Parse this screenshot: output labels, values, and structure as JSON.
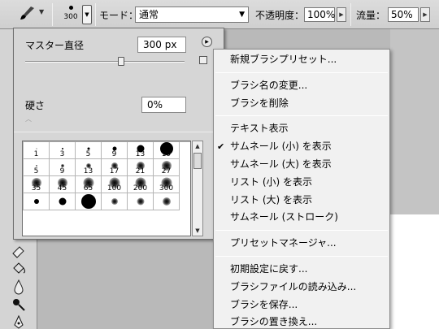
{
  "options_bar": {
    "brush_size": "300",
    "mode_label": "モード：",
    "mode_value": "通常",
    "opacity_label": "不透明度：",
    "opacity_value": "100%",
    "flow_label": "流量：",
    "flow_value": "50%"
  },
  "brush_panel": {
    "master_diameter_label": "マスター直径",
    "master_diameter_value": "300 px",
    "master_diameter_fraction": 0.6,
    "hardness_label": "硬さ",
    "hardness_value": "0%",
    "brushes": [
      {
        "label": "1",
        "style": "hard"
      },
      {
        "label": "3",
        "style": "hard"
      },
      {
        "label": "5",
        "style": "hard"
      },
      {
        "label": "9",
        "style": "hard"
      },
      {
        "label": "13",
        "style": "hard"
      },
      {
        "label": "19",
        "style": "hard"
      },
      {
        "label": "5",
        "style": "soft"
      },
      {
        "label": "9",
        "style": "soft"
      },
      {
        "label": "13",
        "style": "soft"
      },
      {
        "label": "17",
        "style": "soft"
      },
      {
        "label": "21",
        "style": "soft"
      },
      {
        "label": "27",
        "style": "soft"
      },
      {
        "label": "35",
        "style": "soft"
      },
      {
        "label": "45",
        "style": "soft"
      },
      {
        "label": "65",
        "style": "soft"
      },
      {
        "label": "100",
        "style": "soft"
      },
      {
        "label": "200",
        "style": "soft"
      },
      {
        "label": "300",
        "style": "soft"
      },
      {
        "label": "",
        "style": "hard"
      },
      {
        "label": "",
        "style": "hard"
      },
      {
        "label": "",
        "style": "hard"
      },
      {
        "label": "",
        "style": "soft"
      },
      {
        "label": "",
        "style": "soft"
      },
      {
        "label": "",
        "style": "soft"
      }
    ]
  },
  "context_menu": {
    "items": [
      {
        "label": "新規ブラシプリセット...",
        "checked": false
      },
      {
        "sep": true
      },
      {
        "label": "ブラシ名の変更...",
        "checked": false
      },
      {
        "label": "ブラシを削除",
        "checked": false
      },
      {
        "sep": true
      },
      {
        "label": "テキスト表示",
        "checked": false
      },
      {
        "label": "サムネール (小) を表示",
        "checked": true
      },
      {
        "label": "サムネール (大) を表示",
        "checked": false
      },
      {
        "label": "リスト (小) を表示",
        "checked": false
      },
      {
        "label": "リスト (大) を表示",
        "checked": false
      },
      {
        "label": "サムネール (ストローク)",
        "checked": false
      },
      {
        "sep": true
      },
      {
        "label": "プリセットマネージャ...",
        "checked": false
      },
      {
        "sep": true
      },
      {
        "label": "初期設定に戻す...",
        "checked": false
      },
      {
        "label": "ブラシファイルの読み込み...",
        "checked": false
      },
      {
        "label": "ブラシを保存...",
        "checked": false
      },
      {
        "label": "ブラシの置き換え...",
        "checked": false
      }
    ],
    "check_glyph": "✔"
  },
  "icons": {
    "brush_tool": "brush-tool-icon",
    "menu_arrow": "circle-arrow-icon",
    "tools": [
      "eraser-icon",
      "paint-bucket-icon",
      "blur-icon",
      "dodge-icon",
      "pen-icon"
    ]
  },
  "colors": {
    "menu_bg": "#f1f1f1",
    "panel_bg": "#d6d6d6",
    "toolbar_bg": "#d4d4d4"
  }
}
